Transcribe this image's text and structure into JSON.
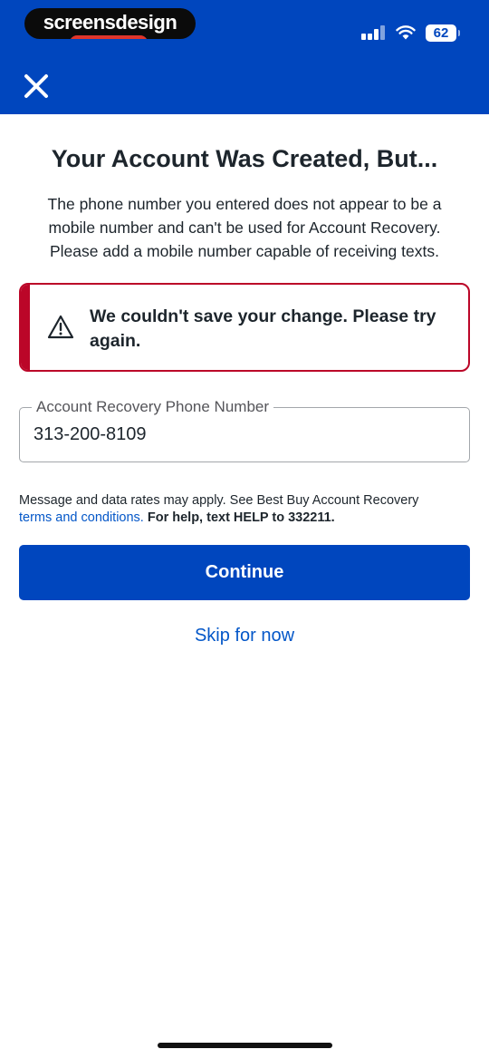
{
  "watermark": {
    "text": "screensdesign"
  },
  "status_bar": {
    "battery": "62"
  },
  "header": {
    "close_icon": "close-icon"
  },
  "main": {
    "title": "Your Account Was Created, But...",
    "subtitle": "The phone number you entered does not appear to be a mobile number and can't be used for Account Recovery. Please add a mobile number capable of receiving texts."
  },
  "alert": {
    "icon": "warning-icon",
    "message": "We couldn't save your change. Please try again."
  },
  "phone_field": {
    "label": "Account Recovery Phone Number",
    "value": "313-200-8109"
  },
  "disclaimer": {
    "prefix": "Message and data rates may apply. See Best Buy Account Recovery",
    "link": "terms and conditions.",
    "help": "For help, text HELP to 332211."
  },
  "actions": {
    "continue_label": "Continue",
    "skip_label": "Skip for now"
  },
  "colors": {
    "brand_blue": "#0046be",
    "link_blue": "#0457c8",
    "error_red": "#bb0628"
  }
}
